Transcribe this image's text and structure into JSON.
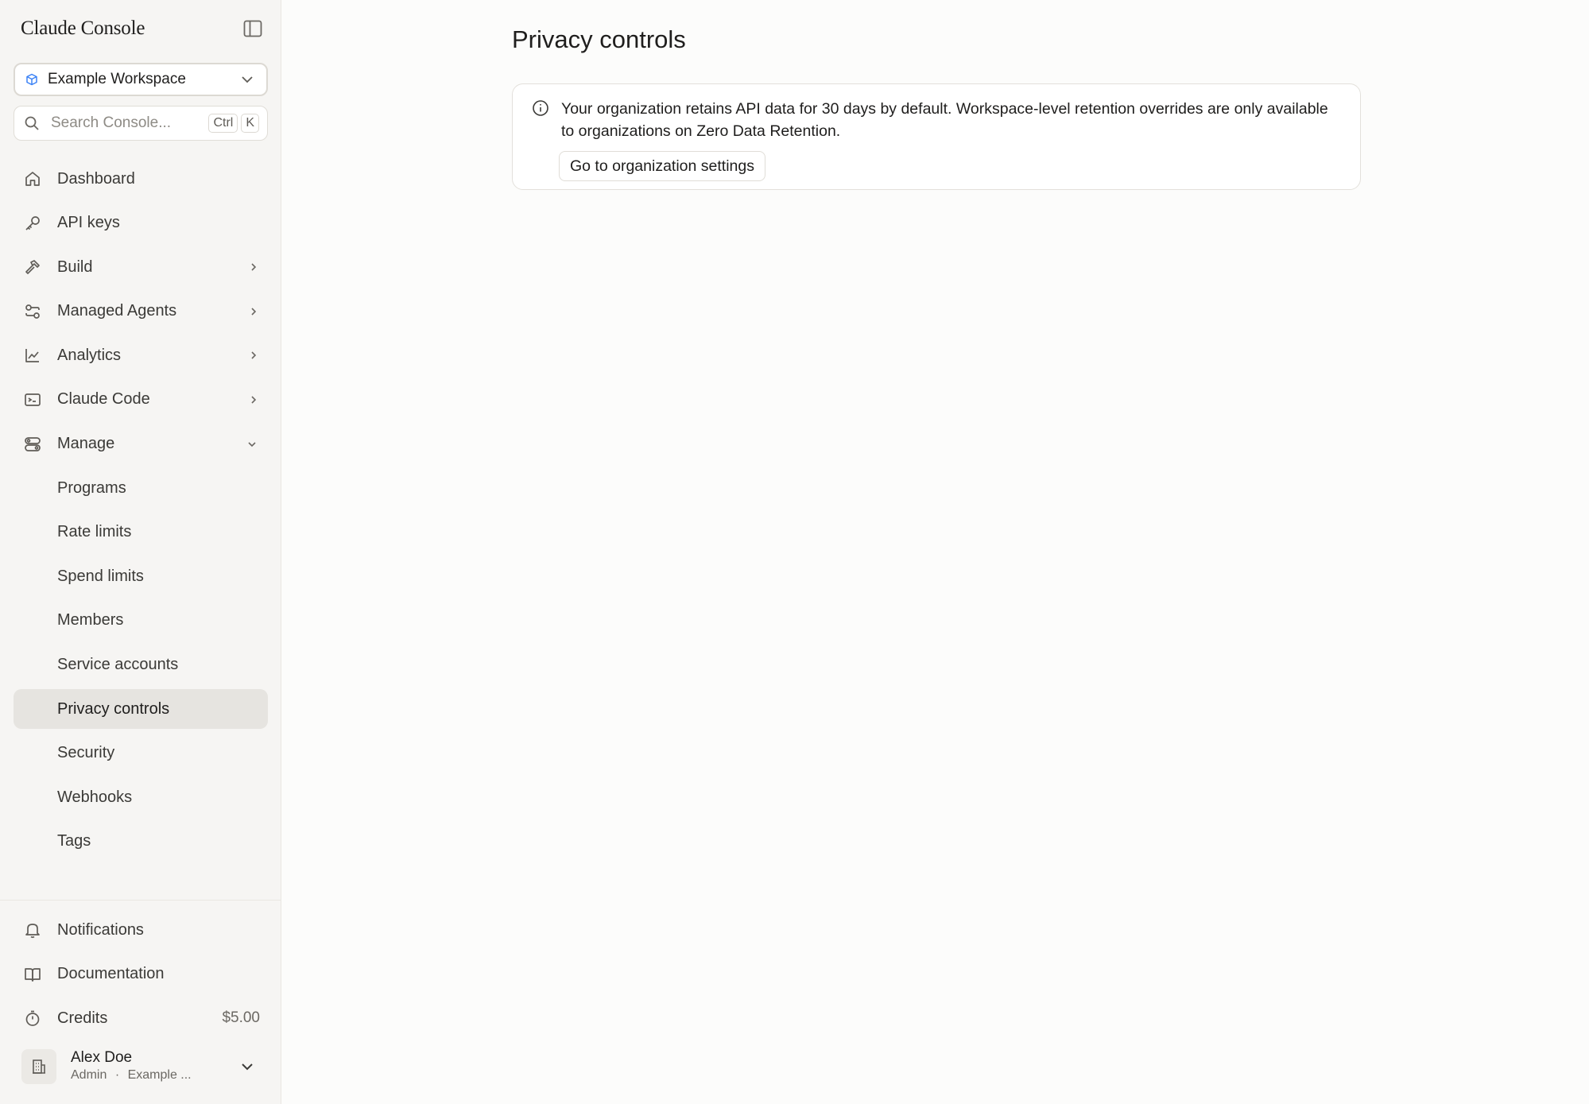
{
  "app": {
    "brand": "Claude Console"
  },
  "workspace": {
    "name": "Example Workspace"
  },
  "search": {
    "placeholder": "Search Console...",
    "shortcut_1": "Ctrl",
    "shortcut_2": "K"
  },
  "nav": {
    "dashboard": "Dashboard",
    "api_keys": "API keys",
    "build": "Build",
    "managed_agents": "Managed Agents",
    "analytics": "Analytics",
    "claude_code": "Claude Code",
    "manage": "Manage",
    "sub": {
      "programs": "Programs",
      "rate_limits": "Rate limits",
      "spend_limits": "Spend limits",
      "members": "Members",
      "service_accounts": "Service accounts",
      "privacy_controls": "Privacy controls",
      "security": "Security",
      "webhooks": "Webhooks",
      "tags": "Tags"
    }
  },
  "bottom": {
    "notifications": "Notifications",
    "documentation": "Documentation",
    "credits": "Credits",
    "credits_value": "$5.00"
  },
  "user": {
    "name": "Alex Doe",
    "role": "Admin",
    "separator": "·",
    "org": "Example ..."
  },
  "main": {
    "title": "Privacy controls",
    "notice_text": "Your organization retains API data for 30 days by default. Workspace-level retention overrides are only available to organizations on Zero Data Retention.",
    "notice_button": "Go to organization settings"
  },
  "colors": {
    "accent_blue": "#3b82f6",
    "active_bg": "#e6e4e0",
    "sidebar_bg": "#f6f5f3"
  }
}
